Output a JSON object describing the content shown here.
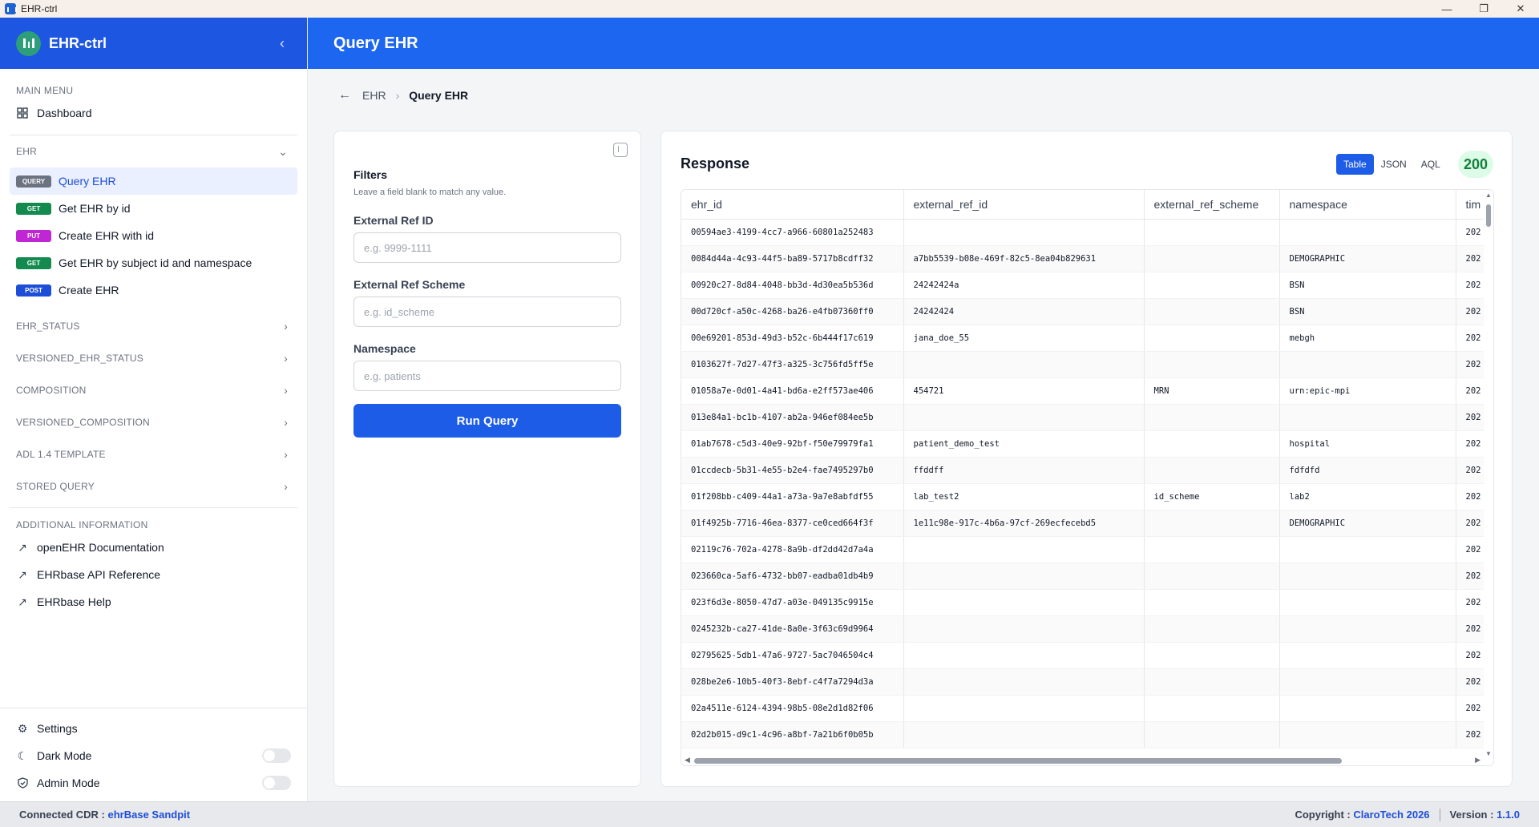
{
  "window": {
    "title": "EHR-ctrl",
    "minimize": "—",
    "maximize": "❐",
    "close": "✕"
  },
  "sidebar": {
    "brand": "EHR-ctrl",
    "main_menu_label": "MAIN MENU",
    "dashboard_label": "Dashboard",
    "ehr_group_label": "EHR",
    "endpoints": [
      {
        "method": "QUERY",
        "label": "Query EHR",
        "active": true
      },
      {
        "method": "GET",
        "label": "Get EHR by id"
      },
      {
        "method": "PUT",
        "label": "Create EHR with id"
      },
      {
        "method": "GET",
        "label": "Get EHR by subject id and namespace"
      },
      {
        "method": "POST",
        "label": "Create EHR"
      }
    ],
    "groups": [
      "EHR_STATUS",
      "VERSIONED_EHR_STATUS",
      "COMPOSITION",
      "VERSIONED_COMPOSITION",
      "ADL 1.4 TEMPLATE",
      "STORED QUERY"
    ],
    "additional_label": "ADDITIONAL INFORMATION",
    "links": [
      "openEHR Documentation",
      "EHRbase API Reference",
      "EHRbase Help"
    ],
    "settings_label": "Settings",
    "dark_mode_label": "Dark Mode",
    "admin_mode_label": "Admin Mode",
    "dark_mode_on": false,
    "admin_mode_on": false
  },
  "header": {
    "title": "Query EHR"
  },
  "breadcrumb": {
    "parent": "EHR",
    "current": "Query EHR"
  },
  "filters": {
    "title": "Filters",
    "subtitle": "Leave a field blank to match any value.",
    "ext_ref_id_label": "External Ref ID",
    "ext_ref_id_placeholder": "e.g. 9999-1111",
    "ext_ref_scheme_label": "External Ref Scheme",
    "ext_ref_scheme_placeholder": "e.g. id_scheme",
    "namespace_label": "Namespace",
    "namespace_placeholder": "e.g. patients",
    "run_label": "Run Query"
  },
  "response": {
    "title": "Response",
    "tabs": [
      "Table",
      "JSON",
      "AQL"
    ],
    "active_tab": "Table",
    "status": "200",
    "columns": [
      "ehr_id",
      "external_ref_id",
      "external_ref_scheme",
      "namespace",
      "tim"
    ],
    "rows": [
      [
        "00594ae3-4199-4cc7-a966-60801a252483",
        "",
        "",
        "",
        "202"
      ],
      [
        "0084d44a-4c93-44f5-ba89-5717b8cdff32",
        "a7bb5539-b08e-469f-82c5-8ea04b829631",
        "",
        "DEMOGRAPHIC",
        "202"
      ],
      [
        "00920c27-8d84-4048-bb3d-4d30ea5b536d",
        "24242424a",
        "",
        "BSN",
        "202"
      ],
      [
        "00d720cf-a50c-4268-ba26-e4fb07360ff0",
        "24242424",
        "",
        "BSN",
        "202"
      ],
      [
        "00e69201-853d-49d3-b52c-6b444f17c619",
        "jana_doe_55",
        "",
        "mebgh",
        "202"
      ],
      [
        "0103627f-7d27-47f3-a325-3c756fd5ff5e",
        "",
        "",
        "",
        "202"
      ],
      [
        "01058a7e-0d01-4a41-bd6a-e2ff573ae406",
        "454721",
        "MRN",
        "urn:epic-mpi",
        "202"
      ],
      [
        "013e84a1-bc1b-4107-ab2a-946ef084ee5b",
        "",
        "",
        "",
        "202"
      ],
      [
        "01ab7678-c5d3-40e9-92bf-f50e79979fa1",
        "patient_demo_test",
        "",
        "hospital",
        "202"
      ],
      [
        "01ccdecb-5b31-4e55-b2e4-fae7495297b0",
        "ffddff",
        "",
        "fdfdfd",
        "202"
      ],
      [
        "01f208bb-c409-44a1-a73a-9a7e8abfdf55",
        "lab_test2",
        "id_scheme",
        "lab2",
        "202"
      ],
      [
        "01f4925b-7716-46ea-8377-ce0ced664f3f",
        "1e11c98e-917c-4b6a-97cf-269ecfecebd5",
        "",
        "DEMOGRAPHIC",
        "202"
      ],
      [
        "02119c76-702a-4278-8a9b-df2dd42d7a4a",
        "",
        "",
        "",
        "202"
      ],
      [
        "023660ca-5af6-4732-bb07-eadba01db4b9",
        "",
        "",
        "",
        "202"
      ],
      [
        "023f6d3e-8050-47d7-a03e-049135c9915e",
        "",
        "",
        "",
        "202"
      ],
      [
        "0245232b-ca27-41de-8a0e-3f63c69d9964",
        "",
        "",
        "",
        "202"
      ],
      [
        "02795625-5db1-47a6-9727-5ac7046504c4",
        "",
        "",
        "",
        "202"
      ],
      [
        "028be2e6-10b5-40f3-8ebf-c4f7a7294d3a",
        "",
        "",
        "",
        "202"
      ],
      [
        "02a4511e-6124-4394-98b5-08e2d1d82f06",
        "",
        "",
        "",
        "202"
      ],
      [
        "02d2b015-d9c1-4c96-a8bf-7a21b6f0b05b",
        "",
        "",
        "",
        "202"
      ]
    ]
  },
  "footer": {
    "connected_label": "Connected CDR :",
    "connected_value": "ehrBase Sandpit",
    "copyright_label": "Copyright :",
    "copyright_value": "ClaroTech 2026",
    "version_label": "Version :",
    "version_value": "1.1.0"
  }
}
